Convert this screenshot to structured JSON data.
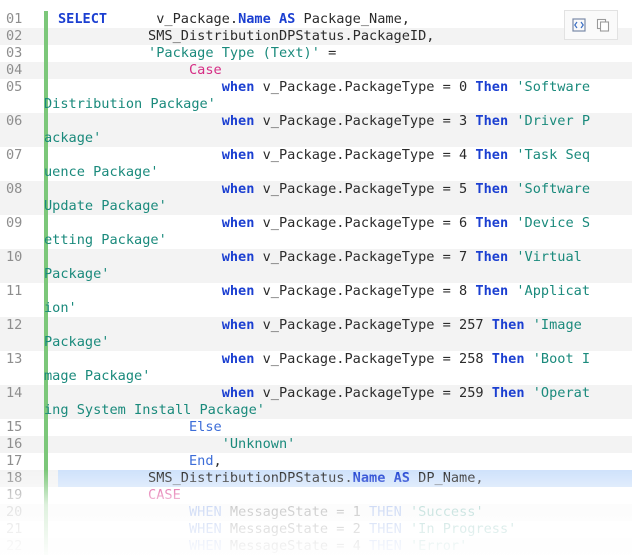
{
  "toolbar": {
    "view_source_icon": "view-source-icon",
    "copy_icon": "copy-icon"
  },
  "lines": [
    {
      "n": "01",
      "tokens": [
        [
          "kw",
          "SELECT"
        ],
        [
          "",
          "      v_Package."
        ],
        [
          "kw",
          "Name"
        ],
        [
          "",
          ""
        ],
        [
          "kw",
          " AS"
        ],
        [
          "",
          " Package_Name,"
        ]
      ]
    },
    {
      "n": "02",
      "tokens": [
        [
          "",
          "           SMS_DistributionDPStatus.PackageID,"
        ]
      ]
    },
    {
      "n": "03",
      "tokens": [
        [
          "",
          "           "
        ],
        [
          "str",
          "'Package Type (Text)'"
        ],
        [
          "",
          " ="
        ]
      ]
    },
    {
      "n": "04",
      "tokens": [
        [
          "",
          "                "
        ],
        [
          "mag",
          "Case"
        ]
      ]
    },
    {
      "n": "05",
      "tokens": [
        [
          "",
          "                    "
        ],
        [
          "kw",
          "when"
        ],
        [
          "",
          " v_Package.PackageType = 0 "
        ],
        [
          "kw",
          "Then"
        ],
        [
          "",
          " "
        ],
        [
          "str",
          "'Software"
        ]
      ],
      "cont": [
        [
          "str",
          "Distribution Package'"
        ]
      ]
    },
    {
      "n": "06",
      "tokens": [
        [
          "",
          "                    "
        ],
        [
          "kw",
          "when"
        ],
        [
          "",
          " v_Package.PackageType = 3 "
        ],
        [
          "kw",
          "Then"
        ],
        [
          "",
          " "
        ],
        [
          "str",
          "'Driver P"
        ]
      ],
      "cont": [
        [
          "str",
          "ackage'"
        ]
      ]
    },
    {
      "n": "07",
      "tokens": [
        [
          "",
          "                    "
        ],
        [
          "kw",
          "when"
        ],
        [
          "",
          " v_Package.PackageType = 4 "
        ],
        [
          "kw",
          "Then"
        ],
        [
          "",
          " "
        ],
        [
          "str",
          "'Task Seq"
        ]
      ],
      "cont": [
        [
          "str",
          "uence Package'"
        ]
      ]
    },
    {
      "n": "08",
      "tokens": [
        [
          "",
          "                    "
        ],
        [
          "kw",
          "when"
        ],
        [
          "",
          " v_Package.PackageType = 5 "
        ],
        [
          "kw",
          "Then"
        ],
        [
          "",
          " "
        ],
        [
          "str",
          "'Software"
        ]
      ],
      "cont": [
        [
          "str",
          "Update Package'"
        ]
      ]
    },
    {
      "n": "09",
      "tokens": [
        [
          "",
          "                    "
        ],
        [
          "kw",
          "when"
        ],
        [
          "",
          " v_Package.PackageType = 6 "
        ],
        [
          "kw",
          "Then"
        ],
        [
          "",
          " "
        ],
        [
          "str",
          "'Device S"
        ]
      ],
      "cont": [
        [
          "str",
          "etting Package'"
        ]
      ]
    },
    {
      "n": "10",
      "tokens": [
        [
          "",
          "                    "
        ],
        [
          "kw",
          "when"
        ],
        [
          "",
          " v_Package.PackageType = 7 "
        ],
        [
          "kw",
          "Then"
        ],
        [
          "",
          " "
        ],
        [
          "str",
          "'Virtual"
        ]
      ],
      "cont": [
        [
          "str",
          "Package'"
        ]
      ]
    },
    {
      "n": "11",
      "tokens": [
        [
          "",
          "                    "
        ],
        [
          "kw",
          "when"
        ],
        [
          "",
          " v_Package.PackageType = 8 "
        ],
        [
          "kw",
          "Then"
        ],
        [
          "",
          " "
        ],
        [
          "str",
          "'Applicat"
        ]
      ],
      "cont": [
        [
          "str",
          "ion'"
        ]
      ]
    },
    {
      "n": "12",
      "tokens": [
        [
          "",
          "                    "
        ],
        [
          "kw",
          "when"
        ],
        [
          "",
          " v_Package.PackageType = 257 "
        ],
        [
          "kw",
          "Then"
        ],
        [
          "",
          " "
        ],
        [
          "str",
          "'Image"
        ]
      ],
      "cont": [
        [
          "str",
          "Package'"
        ]
      ]
    },
    {
      "n": "13",
      "tokens": [
        [
          "",
          "                    "
        ],
        [
          "kw",
          "when"
        ],
        [
          "",
          " v_Package.PackageType = 258 "
        ],
        [
          "kw",
          "Then"
        ],
        [
          "",
          " "
        ],
        [
          "str",
          "'Boot I"
        ]
      ],
      "cont": [
        [
          "str",
          "mage Package'"
        ]
      ]
    },
    {
      "n": "14",
      "tokens": [
        [
          "",
          "                    "
        ],
        [
          "kw",
          "when"
        ],
        [
          "",
          " v_Package.PackageType = 259 "
        ],
        [
          "kw",
          "Then"
        ],
        [
          "",
          " "
        ],
        [
          "str",
          "'Operat"
        ]
      ],
      "cont": [
        [
          "str",
          "ing System Install Package'"
        ]
      ]
    },
    {
      "n": "15",
      "tokens": [
        [
          "",
          "                "
        ],
        [
          "kw2",
          "Else"
        ]
      ]
    },
    {
      "n": "16",
      "tokens": [
        [
          "",
          "                    "
        ],
        [
          "str",
          "'Unknown'"
        ]
      ]
    },
    {
      "n": "17",
      "tokens": [
        [
          "",
          "                "
        ],
        [
          "kw2",
          "End"
        ],
        [
          "",
          ","
        ]
      ]
    },
    {
      "n": "18",
      "highlight": true,
      "tokens": [
        [
          "",
          "           SMS_DistributionDPStatus."
        ],
        [
          "kw",
          "Name"
        ],
        [
          "kw",
          " AS"
        ],
        [
          "",
          " DP_Name,"
        ]
      ]
    },
    {
      "n": "19",
      "tokens": [
        [
          "",
          "           "
        ],
        [
          "mag",
          "CASE"
        ]
      ]
    },
    {
      "n": "20",
      "tokens": [
        [
          "",
          "                "
        ],
        [
          "kw2",
          "WHEN"
        ],
        [
          "",
          " MessageState = 1 "
        ],
        [
          "kw2",
          "THEN"
        ],
        [
          "",
          " "
        ],
        [
          "str",
          "'Success'"
        ]
      ]
    },
    {
      "n": "21",
      "tokens": [
        [
          "",
          "                "
        ],
        [
          "kw2",
          "WHEN"
        ],
        [
          "",
          " MessageState = 2 "
        ],
        [
          "kw2",
          "THEN"
        ],
        [
          "",
          " "
        ],
        [
          "str",
          "'In Progress'"
        ]
      ]
    },
    {
      "n": "22",
      "tokens": [
        [
          "",
          "                "
        ],
        [
          "kw2",
          "WHEN"
        ],
        [
          "",
          " MessageState = 4 "
        ],
        [
          "kw2",
          "THEN"
        ],
        [
          "",
          " "
        ],
        [
          "str",
          "'Error'"
        ]
      ]
    }
  ]
}
